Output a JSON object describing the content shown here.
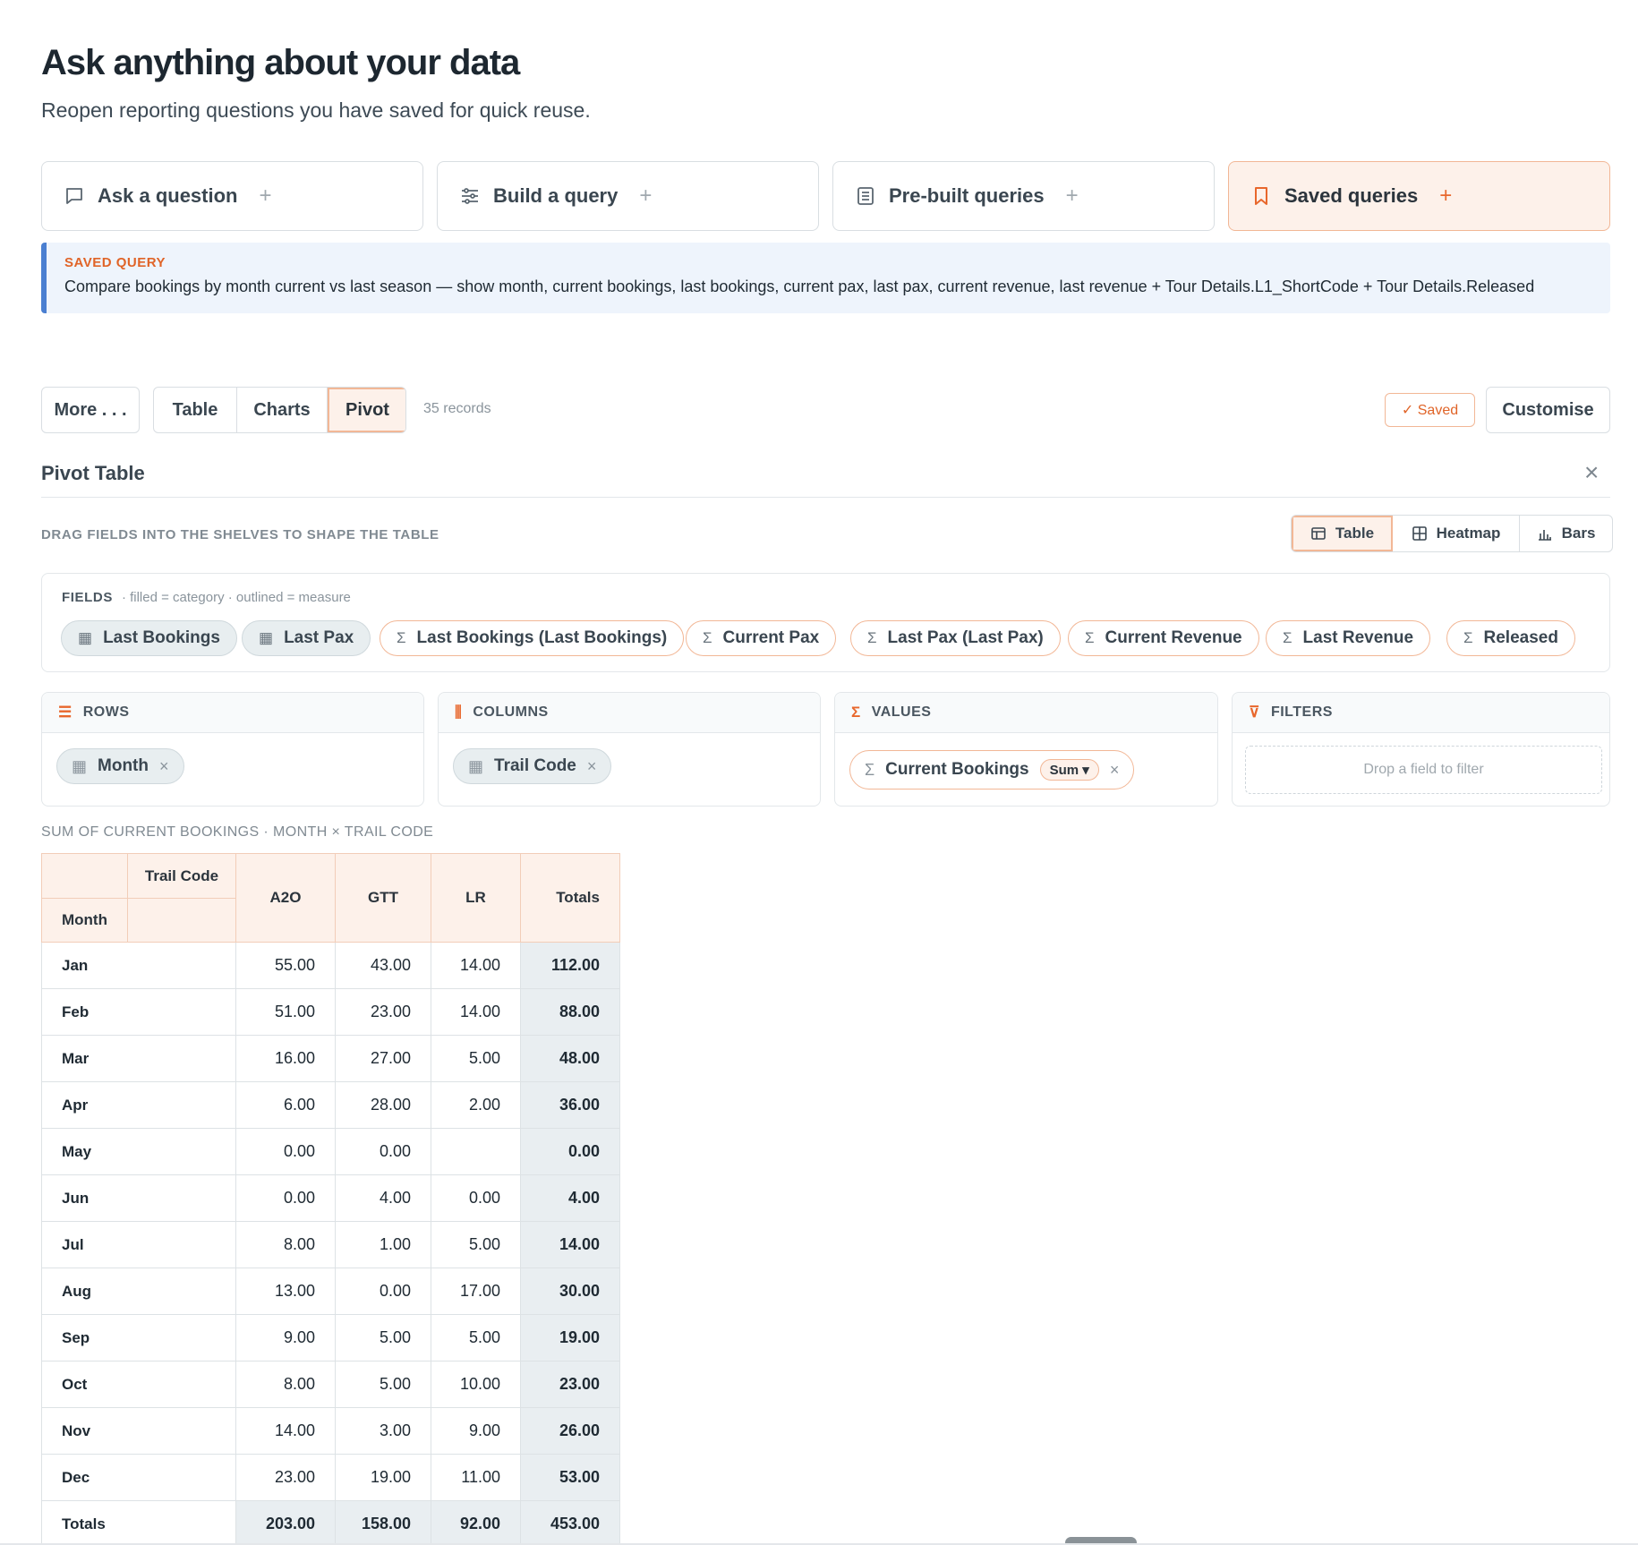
{
  "header": {
    "title": "Ask anything about your data",
    "subtitle": "Reopen reporting questions you have saved for quick reuse."
  },
  "modes": [
    {
      "label": "Ask a question",
      "icon": "chat-bubble-icon",
      "active": false
    },
    {
      "label": "Build a query",
      "icon": "sliders-icon",
      "active": false
    },
    {
      "label": "Pre-built queries",
      "icon": "document-icon",
      "active": false
    },
    {
      "label": "Saved queries",
      "icon": "bookmark-icon",
      "active": true
    }
  ],
  "mode_plus": "+",
  "saved_query": {
    "label": "SAVED QUERY",
    "text": "Compare bookings by month current vs last season — show month, current bookings, last bookings, current pax, last pax, current revenue, last revenue + Tour Details.L1_ShortCode + Tour Details.Released"
  },
  "toolbar": {
    "more_label": "More . . .",
    "tabs": [
      "Table",
      "Charts",
      "Pivot"
    ],
    "active_tab": "Pivot",
    "records": "35 records",
    "saved_label": "✓ Saved",
    "customise_label": "Customise"
  },
  "pivot": {
    "title": "Pivot Table",
    "close_label": "×",
    "drag_hint": "DRAG FIELDS INTO THE SHELVES TO SHAPE THE TABLE",
    "views": [
      "Table",
      "Heatmap",
      "Bars"
    ],
    "active_view": "Table",
    "fields_label": "FIELDS",
    "fields_legend": "· filled = category · outlined = measure",
    "fields": [
      {
        "label": "Last Bookings",
        "kind": "category"
      },
      {
        "label": "Last Pax",
        "kind": "category"
      },
      {
        "label": "Last Bookings (Last Bookings)",
        "kind": "measure"
      },
      {
        "label": "Current Pax",
        "kind": "measure"
      },
      {
        "label": "Last Pax (Last Pax)",
        "kind": "measure"
      },
      {
        "label": "Current Revenue",
        "kind": "measure"
      },
      {
        "label": "Last Revenue",
        "kind": "measure"
      },
      {
        "label": "Released",
        "kind": "measure"
      }
    ],
    "shelves": {
      "rows": {
        "label": "ROWS",
        "field": "Month"
      },
      "columns": {
        "label": "COLUMNS",
        "field": "Trail Code"
      },
      "values": {
        "label": "VALUES",
        "field": "Current Bookings",
        "agg": "Sum"
      },
      "filters": {
        "label": "FILTERS",
        "placeholder": "Drop a field to filter"
      }
    },
    "remove_glyph": "×",
    "caption": "SUM OF CURRENT BOOKINGS · MONTH × TRAIL CODE",
    "table": {
      "corner_col": "Trail Code",
      "corner_row": "Month",
      "columns": [
        "A2O",
        "GTT",
        "LR",
        "Totals"
      ],
      "rows": [
        {
          "month": "Jan",
          "values": [
            "55.00",
            "43.00",
            "14.00"
          ],
          "total": "112.00"
        },
        {
          "month": "Feb",
          "values": [
            "51.00",
            "23.00",
            "14.00"
          ],
          "total": "88.00"
        },
        {
          "month": "Mar",
          "values": [
            "16.00",
            "27.00",
            "5.00"
          ],
          "total": "48.00"
        },
        {
          "month": "Apr",
          "values": [
            "6.00",
            "28.00",
            "2.00"
          ],
          "total": "36.00"
        },
        {
          "month": "May",
          "values": [
            "0.00",
            "0.00",
            ""
          ],
          "total": "0.00"
        },
        {
          "month": "Jun",
          "values": [
            "0.00",
            "4.00",
            "0.00"
          ],
          "total": "4.00"
        },
        {
          "month": "Jul",
          "values": [
            "8.00",
            "1.00",
            "5.00"
          ],
          "total": "14.00"
        },
        {
          "month": "Aug",
          "values": [
            "13.00",
            "0.00",
            "17.00"
          ],
          "total": "30.00"
        },
        {
          "month": "Sep",
          "values": [
            "9.00",
            "5.00",
            "5.00"
          ],
          "total": "19.00"
        },
        {
          "month": "Oct",
          "values": [
            "8.00",
            "5.00",
            "10.00"
          ],
          "total": "23.00"
        },
        {
          "month": "Nov",
          "values": [
            "14.00",
            "3.00",
            "9.00"
          ],
          "total": "26.00"
        },
        {
          "month": "Dec",
          "values": [
            "23.00",
            "19.00",
            "11.00"
          ],
          "total": "53.00"
        }
      ],
      "totals_label": "Totals",
      "totals": [
        "203.00",
        "158.00",
        "92.00",
        "453.00"
      ]
    }
  },
  "colors": {
    "accent": "#e8672c",
    "accent_bg": "#fdf1ea",
    "banner_bg": "#eef4fc",
    "banner_border": "#4a7fd1",
    "totals_bg": "#e9eef1"
  }
}
